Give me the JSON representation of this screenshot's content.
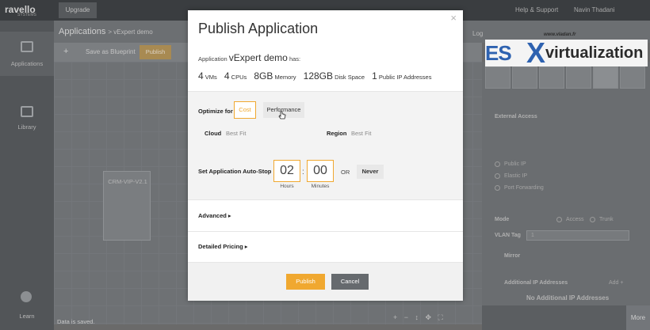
{
  "app": {
    "brand": "ravello",
    "brand_sub": "SYSTEMS",
    "upgrade_label": "Upgrade",
    "help_label": "Help & Support",
    "user_label": "Navin Thadani"
  },
  "sidebar": {
    "items": [
      {
        "label": "Applications"
      },
      {
        "label": "Library"
      },
      {
        "label": "Learn"
      }
    ]
  },
  "breadcrumb": {
    "root": "Applications",
    "current": "> vExpert demo"
  },
  "toolbar": {
    "add_label": "+",
    "save_label": "Save as Blueprint",
    "publish_label": "Publish",
    "log_label": "Log"
  },
  "canvas": {
    "vm_name": "CRM-VIP-V2.1",
    "status": "Data is saved.",
    "zoom_controls": "+ − ↕ ✥ ⛶"
  },
  "right_panel": {
    "external_access": "External Access",
    "public_ip": "Public IP",
    "elastic_ip": "Elastic IP",
    "port_forwarding": "Port Forwarding",
    "mode": "Mode",
    "access": "Access",
    "trunk": "Trunk",
    "vlan_tag": "VLAN Tag",
    "vlan_value": "1",
    "mirror": "Mirror",
    "additional_ip": "Additional IP Addresses",
    "add_label": "Add +",
    "no_additional_ip": "No Additional IP Addresses",
    "more_label": "More"
  },
  "watermark": {
    "site": "www.vladan.fr",
    "brand_esx": "ES",
    "brand_x": "X",
    "brand_virt": "virtualization"
  },
  "modal": {
    "close_glyph": "×",
    "title": "Publish Application",
    "app_prefix": "Application",
    "app_name": "vExpert demo",
    "app_suffix": "has:",
    "resources": [
      {
        "num": "4",
        "unit": "VMs"
      },
      {
        "num": "4",
        "unit": "CPUs"
      },
      {
        "num": "8GB",
        "unit": "Memory"
      },
      {
        "num": "128GB",
        "unit": "Disk Space"
      },
      {
        "num": "1",
        "unit": "Public IP Addresses"
      }
    ],
    "optimize_label": "Optimize for",
    "cost_label": "Cost",
    "performance_label": "Performance",
    "cloud_label": "Cloud",
    "cloud_value": "Best Fit",
    "region_label": "Region",
    "region_value": "Best Fit",
    "autostop_label": "Set Application Auto-Stop",
    "hours_value": "02",
    "hours_label": "Hours",
    "minutes_value": "00",
    "minutes_label": "Minutes",
    "colon": ":",
    "or_label": "OR",
    "never_label": "Never",
    "advanced_label": "Advanced ▸",
    "pricing_label": "Detailed Pricing ▸",
    "publish_label": "Publish",
    "cancel_label": "Cancel"
  },
  "colors": {
    "accent": "#f0a830",
    "cancel": "#666a6e",
    "logo_blue": "#2e62b0"
  }
}
